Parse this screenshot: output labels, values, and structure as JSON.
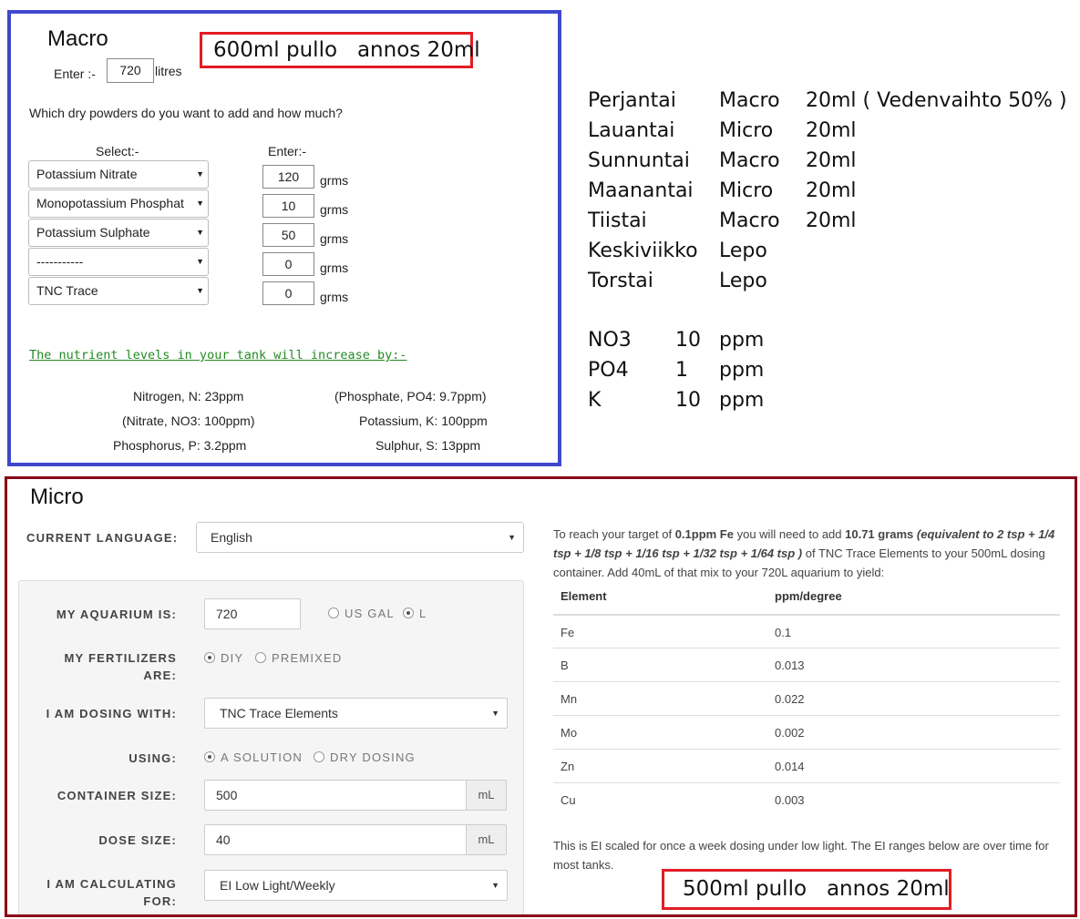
{
  "macro": {
    "title": "Macro",
    "bottle_note": "600ml pullo   annos 20ml",
    "enter_label": "Enter :-",
    "litres_value": "720",
    "litres_unit": "litres",
    "question": "Which dry powders do you want to add and how much?",
    "select_header": "Select:-",
    "enter_header": "Enter:-",
    "powders": [
      {
        "name": "Potassium Nitrate",
        "grams": "120",
        "unit": "grms"
      },
      {
        "name": "Monopotassium Phosphat",
        "grams": "10",
        "unit": "grms"
      },
      {
        "name": "Potassium Sulphate",
        "grams": "50",
        "unit": "grms"
      },
      {
        "name": "-----------",
        "grams": "0",
        "unit": "grms"
      },
      {
        "name": "TNC Trace",
        "grams": "0",
        "unit": "grms"
      }
    ],
    "nutrient_header": "The nutrient levels in your tank will increase by:-",
    "results": {
      "nitrogen": "Nitrogen, N:  23ppm",
      "nitrate": "(Nitrate, NO3:  100ppm)",
      "phosphorus": "Phosphorus, P:  3.2ppm",
      "phosphate": "(Phosphate, PO4:  9.7ppm)",
      "potassium": "Potassium, K:  100ppm",
      "sulphur": "Sulphur, S:  13ppm"
    }
  },
  "schedule": {
    "days": [
      {
        "day": "Perjantai",
        "type": "Macro",
        "dose": "20ml ( Vedenvaihto 50% )"
      },
      {
        "day": "Lauantai",
        "type": "Micro",
        "dose": "20ml"
      },
      {
        "day": "Sunnuntai",
        "type": "Macro",
        "dose": "20ml"
      },
      {
        "day": "Maanantai",
        "type": "Micro",
        "dose": "20ml"
      },
      {
        "day": "Tiistai",
        "type": "Macro",
        "dose": "20ml"
      },
      {
        "day": "Keskiviikko",
        "type": "Lepo",
        "dose": ""
      },
      {
        "day": "Torstai",
        "type": "Lepo",
        "dose": ""
      }
    ],
    "targets": [
      {
        "name": "NO3",
        "value": "10",
        "unit": "ppm"
      },
      {
        "name": "PO4",
        "value": "1",
        "unit": "ppm"
      },
      {
        "name": "K",
        "value": "10",
        "unit": "ppm"
      }
    ]
  },
  "micro": {
    "title": "Micro",
    "language_label": "CURRENT LANGUAGE:",
    "language_value": "English",
    "form": {
      "aquarium_label": "MY AQUARIUM IS:",
      "aquarium_value": "720",
      "unit_us_gal": "US GAL",
      "unit_l": "L",
      "fertilizers_label_1": "MY FERTILIZERS",
      "fertilizers_label_2": "ARE:",
      "opt_diy": "DIY",
      "opt_premixed": "PREMIXED",
      "dosing_label": "I AM DOSING WITH:",
      "dosing_value": "TNC Trace Elements",
      "using_label": "USING:",
      "opt_solution": "A SOLUTION",
      "opt_dry": "DRY DOSING",
      "container_label": "CONTAINER SIZE:",
      "container_value": "500",
      "container_unit": "mL",
      "dose_label": "DOSE SIZE:",
      "dose_value": "40",
      "dose_unit": "mL",
      "calc_label_1": "I AM CALCULATING",
      "calc_label_2": "FOR:",
      "calc_value": "EI Low Light/Weekly"
    },
    "result": {
      "p1": "To reach your target of ",
      "target": "0.1ppm Fe",
      "p2": " you will need to add ",
      "grams": "10.71 grams",
      "p3": " ",
      "equiv": "(equivalent to 2 tsp + 1/4 tsp + 1/8 tsp + 1/16 tsp + 1/32 tsp + 1/64 tsp )",
      "p4": " of TNC Trace Elements to your 500mL dosing container. Add 40mL of that mix to your 720L aquarium to yield:"
    },
    "table": {
      "col_element": "Element",
      "col_ppm": "ppm/degree",
      "rows": [
        {
          "element": "Fe",
          "ppm": "0.1"
        },
        {
          "element": "B",
          "ppm": "0.013"
        },
        {
          "element": "Mn",
          "ppm": "0.022"
        },
        {
          "element": "Mo",
          "ppm": "0.002"
        },
        {
          "element": "Zn",
          "ppm": "0.014"
        },
        {
          "element": "Cu",
          "ppm": "0.003"
        }
      ]
    },
    "footnote": "This is EI scaled for once a week dosing under low light. The EI ranges below are over time for most tanks.",
    "bottle_note": "500ml pullo   annos 20ml"
  }
}
